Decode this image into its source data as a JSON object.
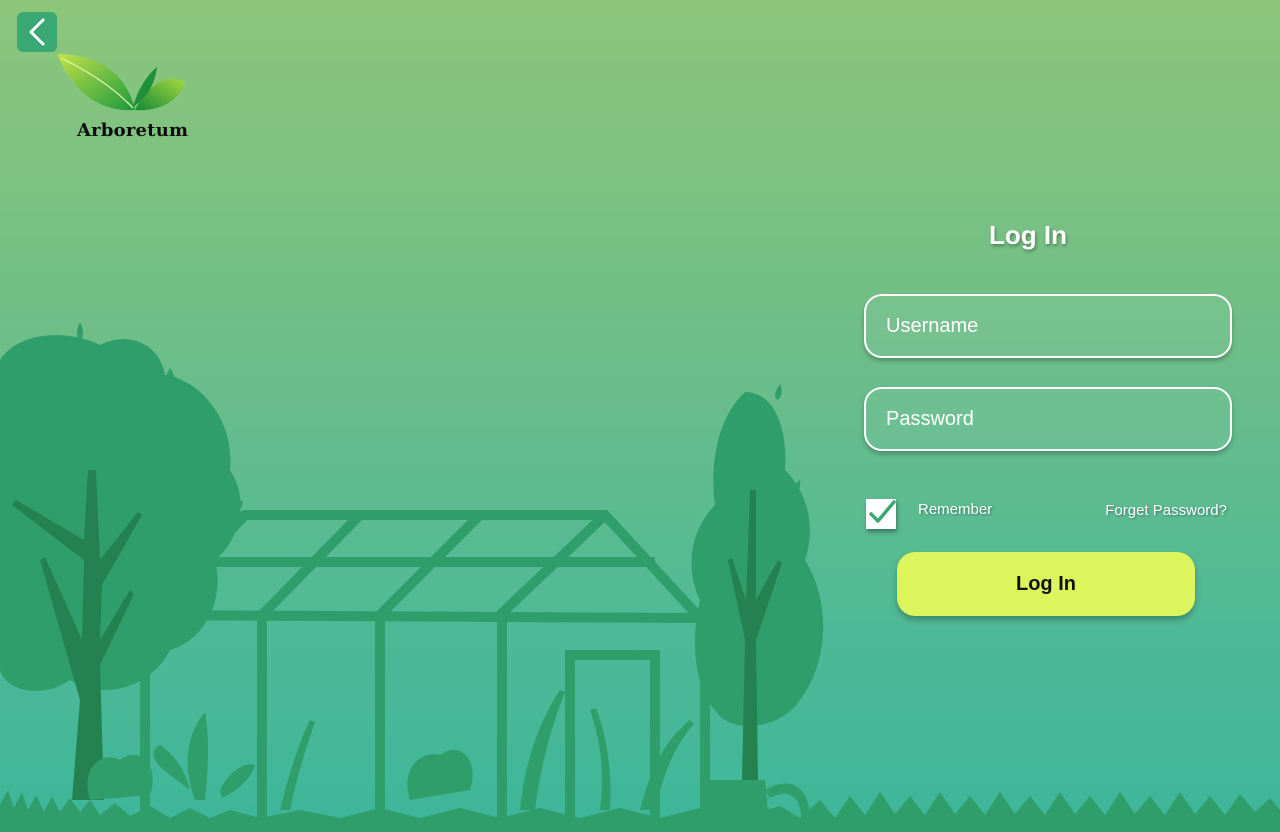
{
  "brand": {
    "name": "Arboretum"
  },
  "nav": {
    "back_icon": "chevron-left-icon"
  },
  "login": {
    "title": "Log In",
    "username_placeholder": "Username",
    "password_placeholder": "Password",
    "remember_label": "Remember",
    "remember_checked": true,
    "forgot_label": "Forget Password?",
    "submit_label": "Log In"
  },
  "colors": {
    "background_top": "#8cc67a",
    "background_bottom": "#3db69a",
    "silhouette": "#2f9e6a",
    "accent_button": "#dcf55c",
    "check": "#3aa873"
  }
}
